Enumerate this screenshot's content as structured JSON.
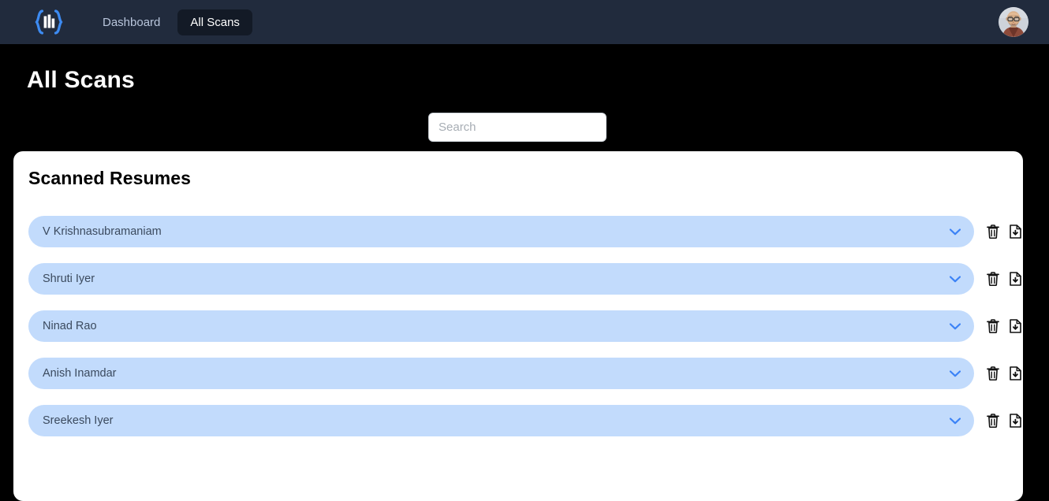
{
  "navbar": {
    "brand_icon": "bar-chart-braces-logo",
    "links": [
      {
        "label": "Dashboard",
        "active": false
      },
      {
        "label": "All Scans",
        "active": true
      }
    ],
    "avatar_icon": "user-avatar-photo"
  },
  "page": {
    "title": "All Scans"
  },
  "search": {
    "value": "",
    "placeholder": "Search"
  },
  "card": {
    "title": "Scanned Resumes",
    "rows": [
      {
        "name": "V Krishnasubramaniam"
      },
      {
        "name": "Shruti Iyer"
      },
      {
        "name": "Ninad Rao"
      },
      {
        "name": "Anish Inamdar"
      },
      {
        "name": "Sreekesh Iyer"
      }
    ],
    "row_icons": {
      "expand": "chevron-down-icon",
      "delete": "trash-icon",
      "download": "file-download-icon"
    }
  },
  "colors": {
    "navbar_bg": "#212b3d",
    "nav_active_bg": "#131a26",
    "page_bg": "#000000",
    "card_bg": "#ffffff",
    "pill_bg": "#c2dbfc",
    "pill_text": "#3b4a5e",
    "chevron": "#3b82f6",
    "brand_blue": "#3d8bf2"
  }
}
